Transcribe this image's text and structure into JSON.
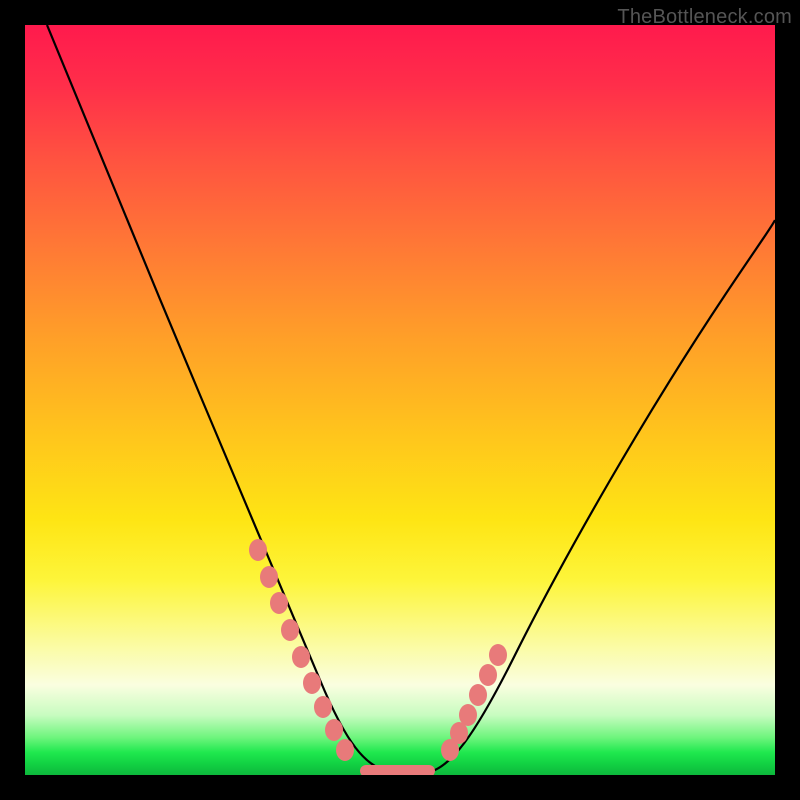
{
  "watermark": "TheBottleneck.com",
  "chart_data": {
    "type": "line",
    "title": "",
    "xlabel": "",
    "ylabel": "",
    "xlim": [
      0,
      100
    ],
    "ylim": [
      0,
      100
    ],
    "grid": false,
    "legend": false,
    "series": [
      {
        "name": "bottleneck-curve",
        "x": [
          3,
          8,
          13,
          18,
          23,
          28,
          31,
          34,
          36,
          38,
          40,
          42,
          44,
          46,
          49,
          53,
          56,
          58,
          60,
          65,
          72,
          80,
          88,
          96,
          100
        ],
        "y": [
          100,
          88,
          76,
          64,
          52,
          40,
          32,
          25,
          20,
          15,
          11,
          7,
          4,
          2,
          0,
          0,
          2,
          5,
          9,
          17,
          29,
          42,
          55,
          67,
          73
        ]
      }
    ],
    "markers": {
      "left_cluster": {
        "x": [
          31,
          33,
          34,
          36,
          37,
          39,
          40,
          42,
          44
        ],
        "y": [
          30,
          26,
          23,
          19,
          16,
          12,
          10,
          7,
          4
        ]
      },
      "right_cluster": {
        "x": [
          56,
          57,
          58,
          59,
          60,
          61
        ],
        "y": [
          3,
          5,
          7,
          9,
          11,
          13
        ]
      },
      "bottom_bar": {
        "x_start": 45,
        "x_end": 54,
        "y": 0
      }
    },
    "marker_color": "#e87a7a",
    "curve_color": "#000000"
  }
}
